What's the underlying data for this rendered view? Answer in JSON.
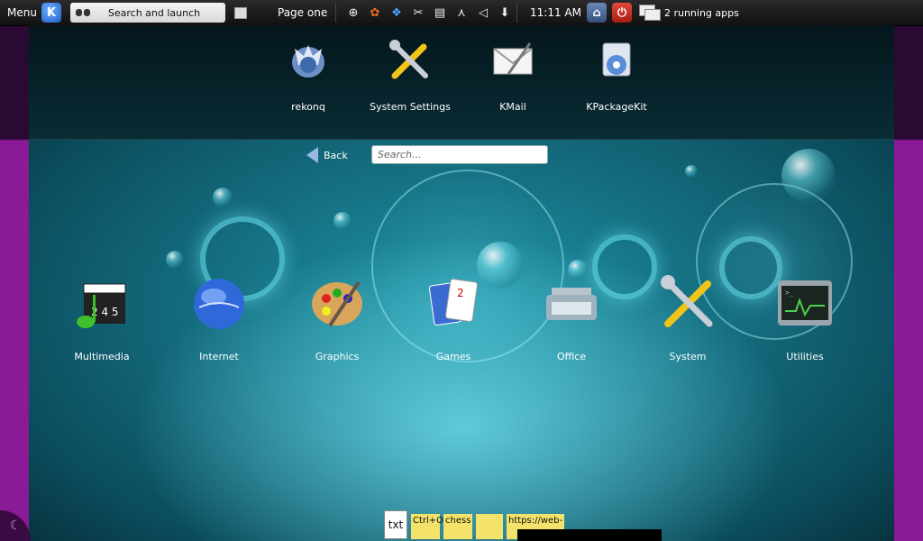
{
  "panel": {
    "menu_label": "Menu",
    "search_launch": "Search and launch",
    "page_label": "Page one",
    "clock": "11:11 AM",
    "running_apps": "2 running apps"
  },
  "favorites": [
    {
      "label": "rekonq"
    },
    {
      "label": "System Settings"
    },
    {
      "label": "KMail"
    },
    {
      "label": "KPackageKit"
    }
  ],
  "navigation": {
    "back_label": "Back",
    "search_placeholder": "Search..."
  },
  "categories": [
    {
      "label": "Multimedia"
    },
    {
      "label": "Internet"
    },
    {
      "label": "Graphics"
    },
    {
      "label": "Games"
    },
    {
      "label": "Office"
    },
    {
      "label": "System"
    },
    {
      "label": "Utilities"
    }
  ],
  "dock": {
    "txt_label": "txt",
    "note1": "Ctrl+O",
    "note2": "chess",
    "note3": "",
    "note4": "https://web-"
  },
  "colors": {
    "side_purple": "#8a1a96",
    "accent_teal": "#1f95a8"
  }
}
